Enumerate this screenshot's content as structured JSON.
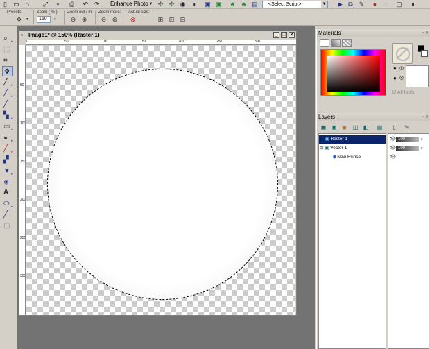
{
  "toolbar": {
    "enhance_label": "Enhance Photo",
    "script_select": "<Select Script>"
  },
  "options": {
    "presets_label": "Presets:",
    "zoom_label": "Zoom ( % ):",
    "zoom_value": "150",
    "zoom_out_label": "Zoom out / in:",
    "zoom_more_label": "Zoom more:",
    "actual_size_label": "Actual size:"
  },
  "document": {
    "title": "Image1* @ 150% (Raster 1)",
    "ruler_h": [
      "0",
      "50",
      "100",
      "150",
      "200",
      "250",
      "300"
    ],
    "ruler_v": [
      "50",
      "100",
      "150",
      "200",
      "250",
      "300"
    ]
  },
  "materials": {
    "title": "Materials",
    "all_tools_label": "All tools",
    "foreground": "#000000",
    "background": "#ffffff"
  },
  "layers": {
    "title": "Layers",
    "items": [
      {
        "name": "Raster 1",
        "opacity": "100"
      },
      {
        "name": "Vector 1",
        "opacity": "100"
      },
      {
        "name": "New Ellipse"
      }
    ]
  }
}
